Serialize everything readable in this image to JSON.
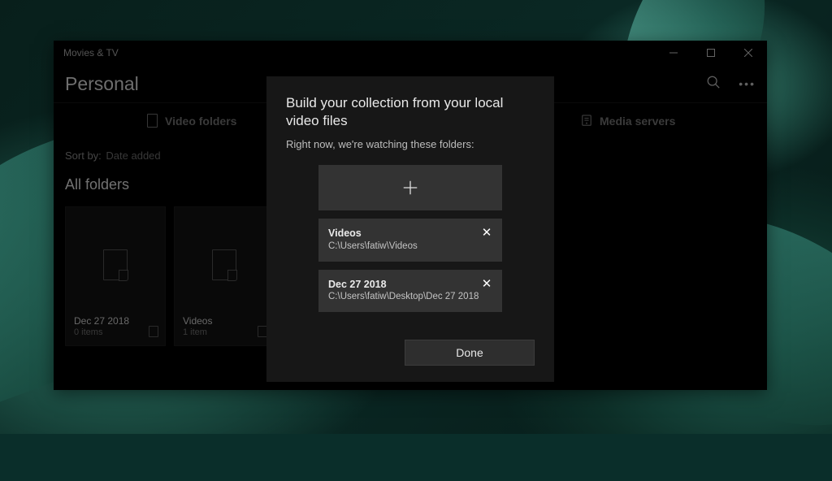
{
  "app": {
    "title": "Movies & TV",
    "page_title": "Personal"
  },
  "tabs": {
    "video_folders": "Video folders",
    "media_servers": "Media servers"
  },
  "sort": {
    "label": "Sort by:",
    "value": "Date added"
  },
  "section": {
    "all_folders": "All folders"
  },
  "folders": [
    {
      "name": "Dec 27 2018",
      "count": "0 items"
    },
    {
      "name": "Videos",
      "count": "1 item"
    }
  ],
  "modal": {
    "title": "Build your collection from your local video files",
    "subtitle": "Right now, we're watching these folders:",
    "entries": [
      {
        "name": "Videos",
        "path": "C:\\Users\\fatiw\\Videos"
      },
      {
        "name": "Dec 27 2018",
        "path": "C:\\Users\\fatiw\\Desktop\\Dec 27 2018"
      }
    ],
    "done": "Done"
  }
}
